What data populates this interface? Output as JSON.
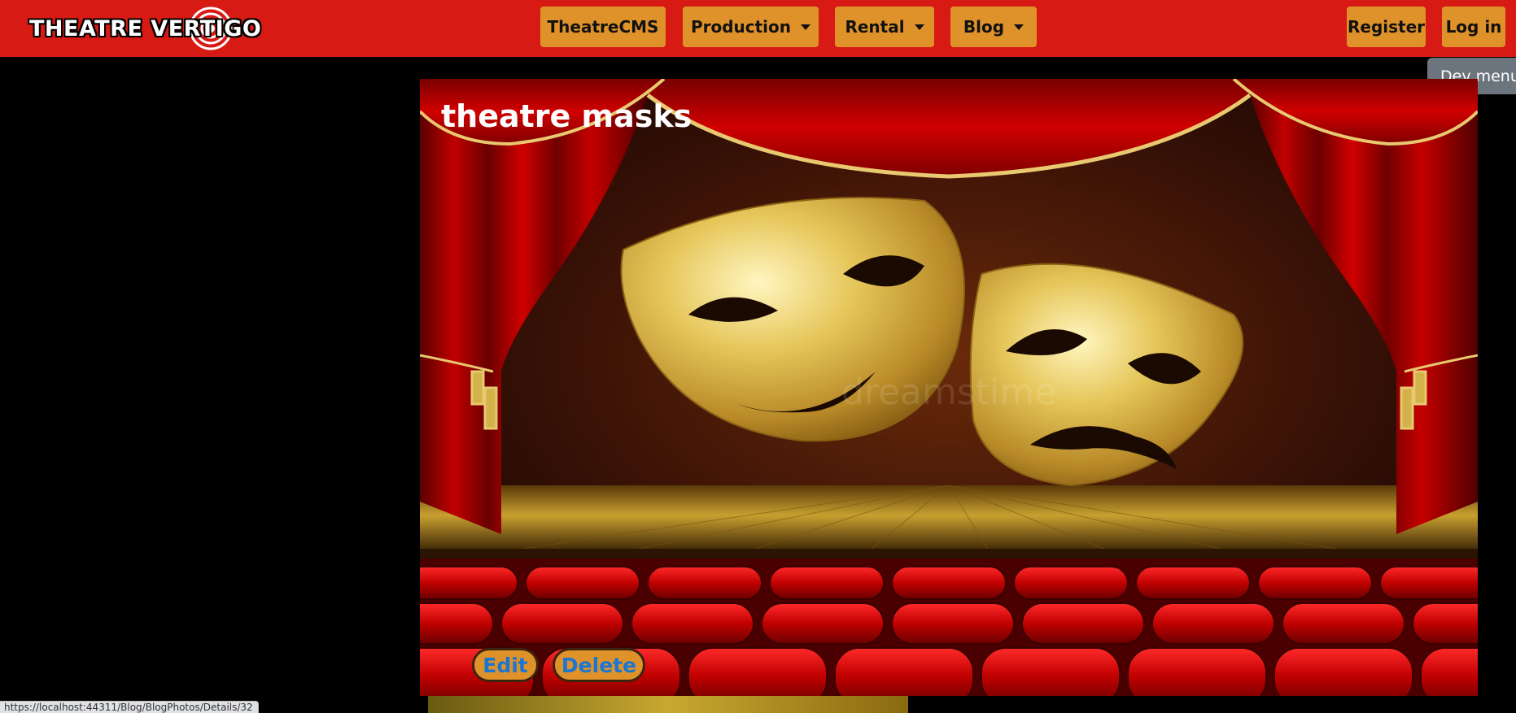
{
  "navbar": {
    "brand": "THEATRE VERTIGO",
    "items": [
      {
        "label": "TheatreCMS",
        "dropdown": false
      },
      {
        "label": "Production",
        "dropdown": true
      },
      {
        "label": "Rental",
        "dropdown": true
      },
      {
        "label": "Blog",
        "dropdown": true
      }
    ],
    "register_label": "Register",
    "login_label": "Log in",
    "background_color": "#d71a14",
    "button_color": "#e0922a"
  },
  "dev_menu": {
    "label": "Dev menu"
  },
  "photo": {
    "title": "theatre masks",
    "edit_label": "Edit",
    "delete_label": "Delete",
    "watermark": "dreamstime"
  },
  "status_bar": {
    "url": "https://localhost:44311/Blog/BlogPhotos/Details/32"
  },
  "colors": {
    "page_background": "#000000",
    "link_color": "#1976d2",
    "curtain_red": "#b00000",
    "gold": "#d4b24a"
  }
}
